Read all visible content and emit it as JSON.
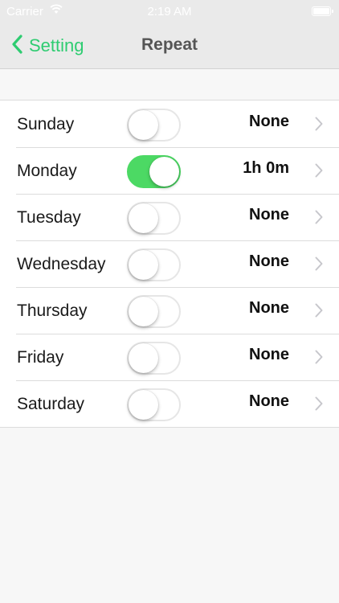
{
  "status_bar": {
    "carrier": "Carrier",
    "time": "2:19 AM",
    "wifi_icon": "wifi-icon",
    "battery_icon": "battery-icon"
  },
  "nav": {
    "back_label": "Setting",
    "back_icon": "chevron-left-icon",
    "title": "Repeat"
  },
  "colors": {
    "accent": "#2ecc71",
    "toggle_on": "#4cd964",
    "background": "#f7f7f7",
    "nav_background": "#eaeaea"
  },
  "days": [
    {
      "label": "Sunday",
      "enabled": false,
      "value": "None"
    },
    {
      "label": "Monday",
      "enabled": true,
      "value": "1h 0m"
    },
    {
      "label": "Tuesday",
      "enabled": false,
      "value": "None"
    },
    {
      "label": "Wednesday",
      "enabled": false,
      "value": "None"
    },
    {
      "label": "Thursday",
      "enabled": false,
      "value": "None"
    },
    {
      "label": "Friday",
      "enabled": false,
      "value": "None"
    },
    {
      "label": "Saturday",
      "enabled": false,
      "value": "None"
    }
  ]
}
